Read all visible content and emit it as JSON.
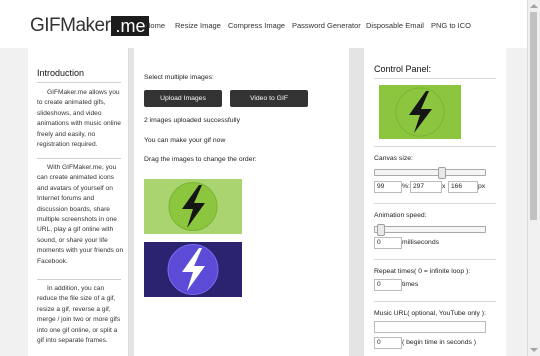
{
  "header": {
    "logo_text": "GIFMaker",
    "logo_box": ".me",
    "nav": [
      {
        "label": "Home"
      },
      {
        "label": "Resize Image"
      },
      {
        "label": "Compress Image"
      },
      {
        "label": "Password Generator"
      },
      {
        "label": "Disposable Email"
      },
      {
        "label": "PNG to ICO"
      }
    ]
  },
  "sidebar": {
    "heading": "Introduction",
    "paragraphs": [
      "GIFMaker.me allows you to create animated gifs, slideshows, and video animations with music online freely and easily, no registration required.",
      "With GIFMaker.me, you can create animated icons and avatars of yourself on Internet forums and discussion boards, share multiple screenshots in one URL, play a gif online with sound, or share your life moments with your friends on Facebook.",
      "In addition, you can reduce the file size of a gif, resize a gif, reverse a gif, merge / join two or more gifs into one gif online, or split a gif into separate frames."
    ]
  },
  "main": {
    "select_label": "Select multiple images:",
    "upload_button": "Upload Images",
    "video_button": "Video to GIF",
    "status": "2 images uploaded successfully",
    "ready": "You can make your gif now",
    "drag_hint": "Drag the images to change the order:",
    "images": [
      {
        "icon": "lightning-icon",
        "bg": "#8cc63f"
      },
      {
        "icon": "lightning-icon",
        "bg": "#3b2d8f"
      }
    ]
  },
  "panel": {
    "title": "Control Panel:",
    "preview_icon": "lightning-icon",
    "canvas_label": "Canvas size:",
    "canvas_scale": "99",
    "canvas_scale_unit": "%:",
    "canvas_width": "297",
    "canvas_x": "x",
    "canvas_height": "166",
    "canvas_unit": "px",
    "canvas_slider_level": 0.62,
    "speed_label": "Animation speed:",
    "speed_value": "0",
    "speed_unit": "milliseconds",
    "speed_slider_level": 0.02,
    "repeat_label": "Repeat times( 0 = infinite loop ):",
    "repeat_value": "0",
    "repeat_unit": "times",
    "music_label": "Music URL( optional, YouTube only ):",
    "music_value": "",
    "begin_value": "0",
    "begin_unit": "( begin time in seconds )"
  },
  "colors": {
    "green": "#8cc63f",
    "purple": "#3b2d8f",
    "button": "#333333"
  }
}
